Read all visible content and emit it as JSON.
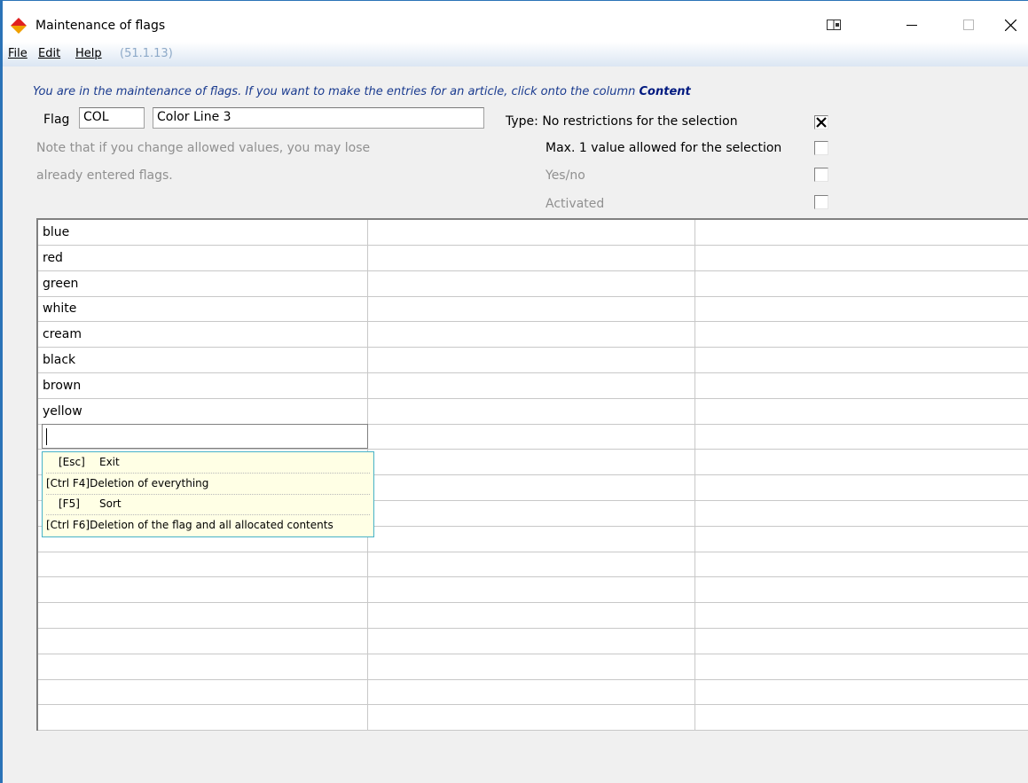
{
  "window": {
    "title": "Maintenance of flags"
  },
  "menu": {
    "items": [
      {
        "label": "File"
      },
      {
        "label": "Edit"
      },
      {
        "label": "Help"
      }
    ],
    "version": "(51.1.13)"
  },
  "info": {
    "text": "You are in the maintenance of flags. If you want to make the entries for an article, click onto the column",
    "emphasis": "Content"
  },
  "flag": {
    "label": "Flag",
    "code": "COL",
    "description": "Color Line 3"
  },
  "note": {
    "line1": "Note that if you change allowed values, you may lose",
    "line2": "already entered flags."
  },
  "options": [
    {
      "label": "Type: No restrictions for the selection",
      "checked": true,
      "enabled": true
    },
    {
      "label": "Max. 1 value allowed for the selection",
      "checked": false,
      "enabled": true
    },
    {
      "label": "Yes/no",
      "checked": false,
      "enabled": false
    },
    {
      "label": "Activated",
      "checked": false,
      "enabled": false
    }
  ],
  "values": [
    "blue",
    "red",
    "green",
    "white",
    "cream",
    "black",
    "brown",
    "yellow"
  ],
  "popup": [
    {
      "key": "[Esc]",
      "action": "Exit"
    },
    {
      "key": "[Ctrl F4]",
      "action": "Deletion of everything"
    },
    {
      "key": "[F5]",
      "action": "Sort"
    },
    {
      "key": "[Ctrl F6]",
      "action": "Deletion of the flag and all allocated contents"
    }
  ],
  "colors": {
    "info_text": "#1a3b8f",
    "accent": "#2b73b7",
    "popup_bg": "#ffffe5"
  },
  "icons": {
    "app": "app-diamond-icon",
    "restore_split": "window-layout-icon",
    "minimize": "minimize-icon",
    "maximize": "maximize-icon",
    "close": "close-icon"
  }
}
